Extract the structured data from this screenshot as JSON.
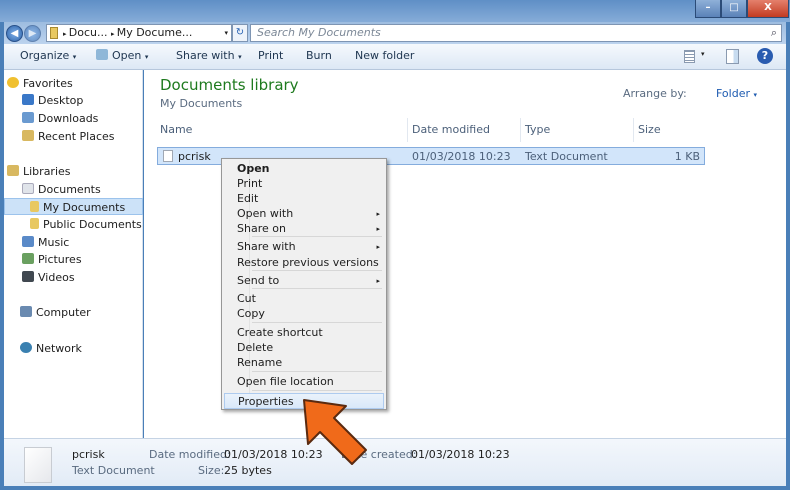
{
  "window": {
    "minimize": "–",
    "maximize": "□",
    "close": "X"
  },
  "address": {
    "back_icon": "back-arrow",
    "forward_icon": "forward-arrow",
    "path": [
      "Docu...",
      "My Docume..."
    ],
    "search_placeholder": "Search My Documents"
  },
  "toolbar": {
    "organize": "Organize",
    "open": "Open",
    "share_with": "Share with",
    "print": "Print",
    "burn": "Burn",
    "new_folder": "New folder"
  },
  "nav": {
    "items": [
      {
        "label": "Favorites",
        "icon": "star"
      },
      {
        "label": "Desktop",
        "icon": "desktop"
      },
      {
        "label": "Downloads",
        "icon": "downloads"
      },
      {
        "label": "Recent Places",
        "icon": "recent"
      },
      {
        "label": "Libraries",
        "icon": "libraries"
      },
      {
        "label": "Documents",
        "icon": "documents"
      },
      {
        "label": "My Documents",
        "icon": "folder"
      },
      {
        "label": "Public Documents",
        "icon": "folder"
      },
      {
        "label": "Music",
        "icon": "music"
      },
      {
        "label": "Pictures",
        "icon": "pictures"
      },
      {
        "label": "Videos",
        "icon": "videos"
      },
      {
        "label": "Computer",
        "icon": "computer"
      },
      {
        "label": "Network",
        "icon": "network"
      }
    ]
  },
  "library": {
    "title": "Documents library",
    "subtitle": "My Documents",
    "arrange_label": "Arrange by:",
    "arrange_value": "Folder"
  },
  "columns": [
    "Name",
    "Date modified",
    "Type",
    "Size"
  ],
  "file": {
    "name": "pcrisk",
    "date": "01/03/2018 10:23",
    "type": "Text Document",
    "size": "1 KB"
  },
  "context_menu": [
    {
      "label": "Open",
      "bold": true
    },
    {
      "label": "Print"
    },
    {
      "label": "Edit"
    },
    {
      "label": "Open with",
      "sub": true
    },
    {
      "label": "Share on",
      "sub": true
    },
    {
      "label": "Share with",
      "sub": true
    },
    {
      "label": "Restore previous versions"
    },
    {
      "label": "Send to",
      "sub": true
    },
    {
      "label": "Cut"
    },
    {
      "label": "Copy"
    },
    {
      "label": "Create shortcut"
    },
    {
      "label": "Delete"
    },
    {
      "label": "Rename"
    },
    {
      "label": "Open file location"
    },
    {
      "label": "Properties",
      "highlight": true
    }
  ],
  "status": {
    "name": "pcrisk",
    "type": "Text Document",
    "date_modified_label": "Date modified:",
    "date_modified": "01/03/2018 10:23",
    "date_created_label": "Date created:",
    "date_created": "01/03/2018 10:23",
    "size_label": "Size:",
    "size": "25 bytes"
  },
  "colors": {
    "library_title": "#1e7a1e",
    "arrow": "#f06a1a",
    "menu_highlight": "#d9e8f9"
  }
}
